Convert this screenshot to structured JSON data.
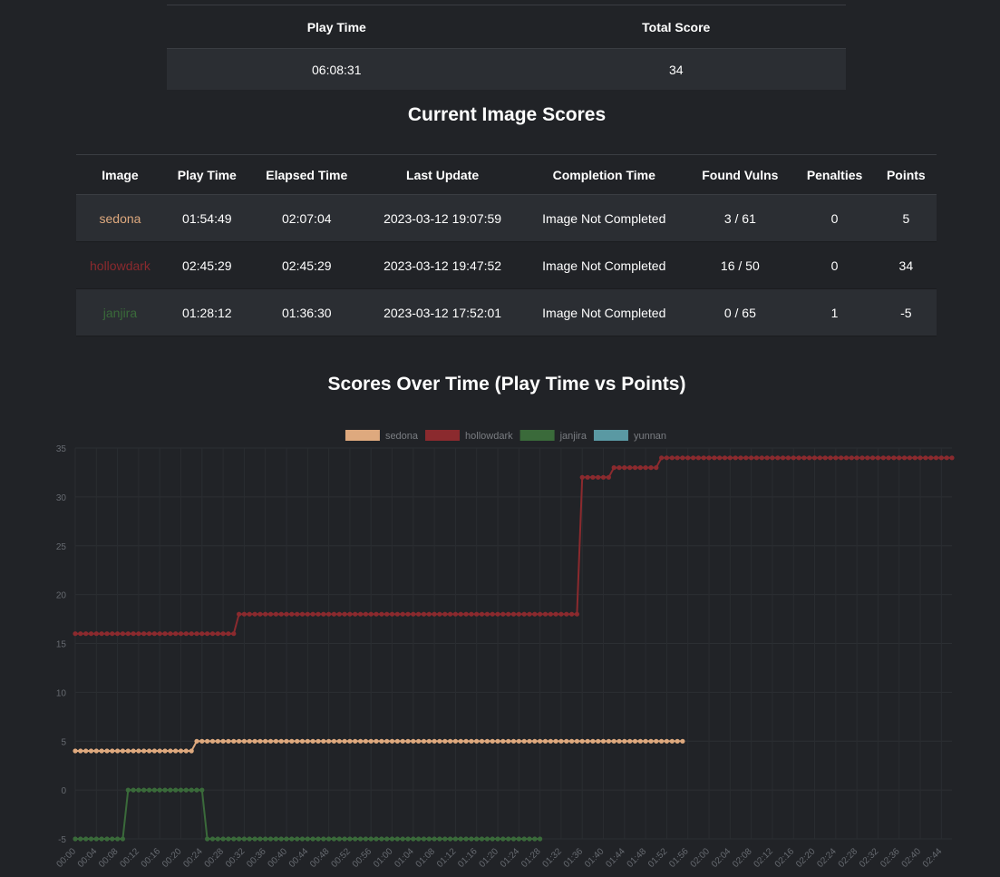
{
  "summary": {
    "headers": [
      "Play Time",
      "Total Score"
    ],
    "values": [
      "06:08:31",
      "34"
    ]
  },
  "images_section": {
    "title": "Current Image Scores",
    "headers": [
      "Image",
      "Play Time",
      "Elapsed Time",
      "Last Update",
      "Completion Time",
      "Found Vulns",
      "Penalties",
      "Points"
    ],
    "rows": [
      {
        "image": "sedona",
        "color": "#dea97e",
        "play_time": "01:54:49",
        "elapsed_time": "02:07:04",
        "last_update": "2023-03-12 19:07:59",
        "completion_time": "Image Not Completed",
        "found_vulns": "3 / 61",
        "penalties": "0",
        "points": "5"
      },
      {
        "image": "hollowdark",
        "color": "#8b2a2e",
        "play_time": "02:45:29",
        "elapsed_time": "02:45:29",
        "last_update": "2023-03-12 19:47:52",
        "completion_time": "Image Not Completed",
        "found_vulns": "16 / 50",
        "penalties": "0",
        "points": "34"
      },
      {
        "image": "janjira",
        "color": "#3a6a3a",
        "play_time": "01:28:12",
        "elapsed_time": "01:36:30",
        "last_update": "2023-03-12 17:52:01",
        "completion_time": "Image Not Completed",
        "found_vulns": "0 / 65",
        "penalties": "1",
        "points": "-5"
      }
    ]
  },
  "chart_title": "Scores Over Time (Play Time vs Points)",
  "chart_data": {
    "type": "line",
    "title": "Scores Over Time (Play Time vs Points)",
    "xlabel": "",
    "ylabel": "",
    "ylim": [
      -5,
      35
    ],
    "yticks": [
      -5,
      0,
      5,
      10,
      15,
      20,
      25,
      30,
      35
    ],
    "xlim": [
      0,
      166
    ],
    "xtick_labels": [
      "00:00",
      "00:04",
      "00:08",
      "00:12",
      "00:16",
      "00:20",
      "00:24",
      "00:28",
      "00:32",
      "00:36",
      "00:40",
      "00:44",
      "00:48",
      "00:52",
      "00:56",
      "01:00",
      "01:04",
      "01:08",
      "01:12",
      "01:16",
      "01:20",
      "01:24",
      "01:28",
      "01:32",
      "01:36",
      "01:40",
      "01:44",
      "01:48",
      "01:52",
      "01:56",
      "02:00",
      "02:04",
      "02:08",
      "02:12",
      "02:16",
      "02:20",
      "02:24",
      "02:28",
      "02:32",
      "02:36",
      "02:40",
      "02:44"
    ],
    "grid": true,
    "legend_position": "top",
    "series": [
      {
        "name": "sedona",
        "color": "#dea97e",
        "x_end": 115,
        "steps": [
          [
            0,
            4
          ],
          [
            22,
            4
          ],
          [
            23,
            5
          ],
          [
            115,
            5
          ]
        ]
      },
      {
        "name": "hollowdark",
        "color": "#8b2a2e",
        "x_end": 166,
        "steps": [
          [
            0,
            16
          ],
          [
            30,
            16
          ],
          [
            30.5,
            18
          ],
          [
            95,
            18
          ],
          [
            96,
            32
          ],
          [
            101,
            32
          ],
          [
            102,
            33
          ],
          [
            110,
            33
          ],
          [
            111,
            34
          ],
          [
            166,
            34
          ]
        ]
      },
      {
        "name": "janjira",
        "color": "#3a6a3a",
        "x_end": 88,
        "steps": [
          [
            0,
            -5
          ],
          [
            9,
            -5
          ],
          [
            10,
            0
          ],
          [
            24,
            0
          ],
          [
            25,
            -5
          ],
          [
            88,
            -5
          ]
        ]
      },
      {
        "name": "yunnan",
        "color": "#5a99a3",
        "x_end": null,
        "steps": []
      }
    ]
  }
}
